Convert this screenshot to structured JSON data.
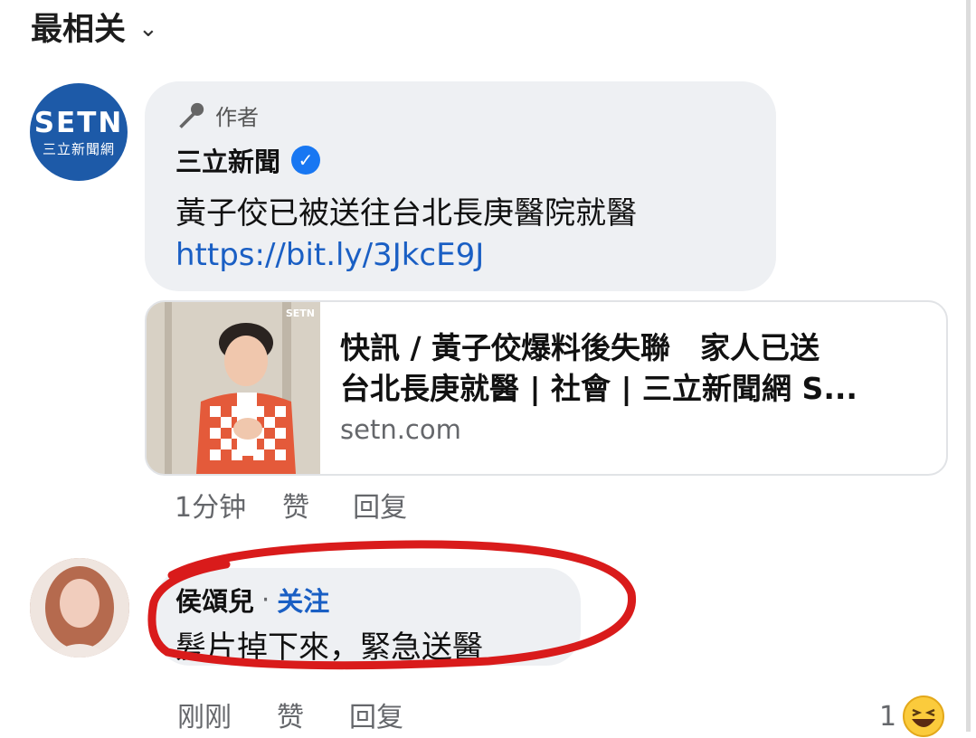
{
  "sort": {
    "label": "最相关"
  },
  "post": {
    "author_badge": "作者",
    "page_name": "三立新聞",
    "logo_text": "SETN",
    "logo_subtext": "三立新聞網",
    "text": "黃子佼已被送往台北長庚醫院就醫",
    "link": "https://bit.ly/3JkcE9J"
  },
  "link_card": {
    "thumb_logo": "SETN",
    "title_line1": "快訊 / 黃子佼爆料後失聯　家人已送",
    "title_line2": "台北長庚就醫 | 社會 | 三立新聞網 S...",
    "domain": "setn.com"
  },
  "post_actions": {
    "time": "1分钟",
    "like": "赞",
    "reply": "回复"
  },
  "comment": {
    "name": "侯頌兒",
    "separator": "·",
    "follow": "关注",
    "text": "髮片掉下來，緊急送醫"
  },
  "comment_actions": {
    "time": "刚刚",
    "like": "赞",
    "reply": "回复",
    "reaction_count": "1"
  }
}
